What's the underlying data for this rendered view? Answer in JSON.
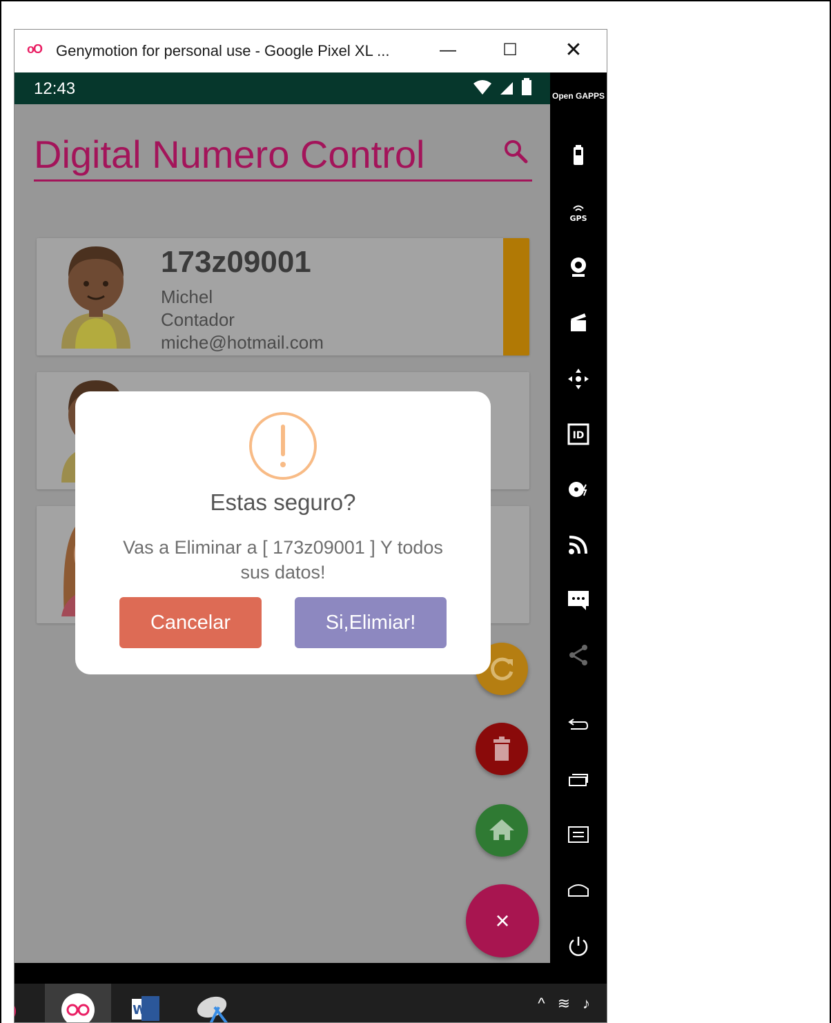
{
  "window": {
    "logo": "oO",
    "title": "Genymotion for personal use - Google Pixel XL ...",
    "minimize_glyph": "—",
    "maximize_glyph": "☐",
    "close_glyph": "✕"
  },
  "statusbar": {
    "time": "12:43",
    "icons": [
      "wifi-icon",
      "signal-icon",
      "battery-icon"
    ]
  },
  "app": {
    "title": "Digital Numero Control",
    "search_icon": "search-icon"
  },
  "cards": [
    {
      "id": "173z09001",
      "name": "Michel",
      "role": "Contador",
      "email": "miche@hotmail.com",
      "strip_color": "#b17905"
    }
  ],
  "dialog": {
    "icon": "warning-icon",
    "title": "Estas seguro?",
    "message": "Vas a Eliminar a [ 173z09001 ] Y todos sus datos!",
    "cancel_label": "Cancelar",
    "confirm_label": "Si,Elimiar!"
  },
  "fabs": {
    "refresh_icon": "refresh-icon",
    "delete_icon": "trash-icon",
    "home_icon": "home-icon",
    "close_label": "×"
  },
  "toolbar": {
    "opengapps_label": "Open GAPPS",
    "items": [
      "battery-icon",
      "gps-icon",
      "webcam-icon",
      "media-icon",
      "dpad-icon",
      "id-icon",
      "disk-icon",
      "cast-icon",
      "sms-icon",
      "share-icon",
      "back-icon",
      "recent-apps-icon",
      "menu-icon",
      "home-icon",
      "power-icon"
    ]
  },
  "colors": {
    "accent": "#a3145a",
    "statusbar": "#06372c",
    "cancel": "#dd6b55",
    "confirm": "#8d88c0",
    "warning": "#f8bb86"
  }
}
